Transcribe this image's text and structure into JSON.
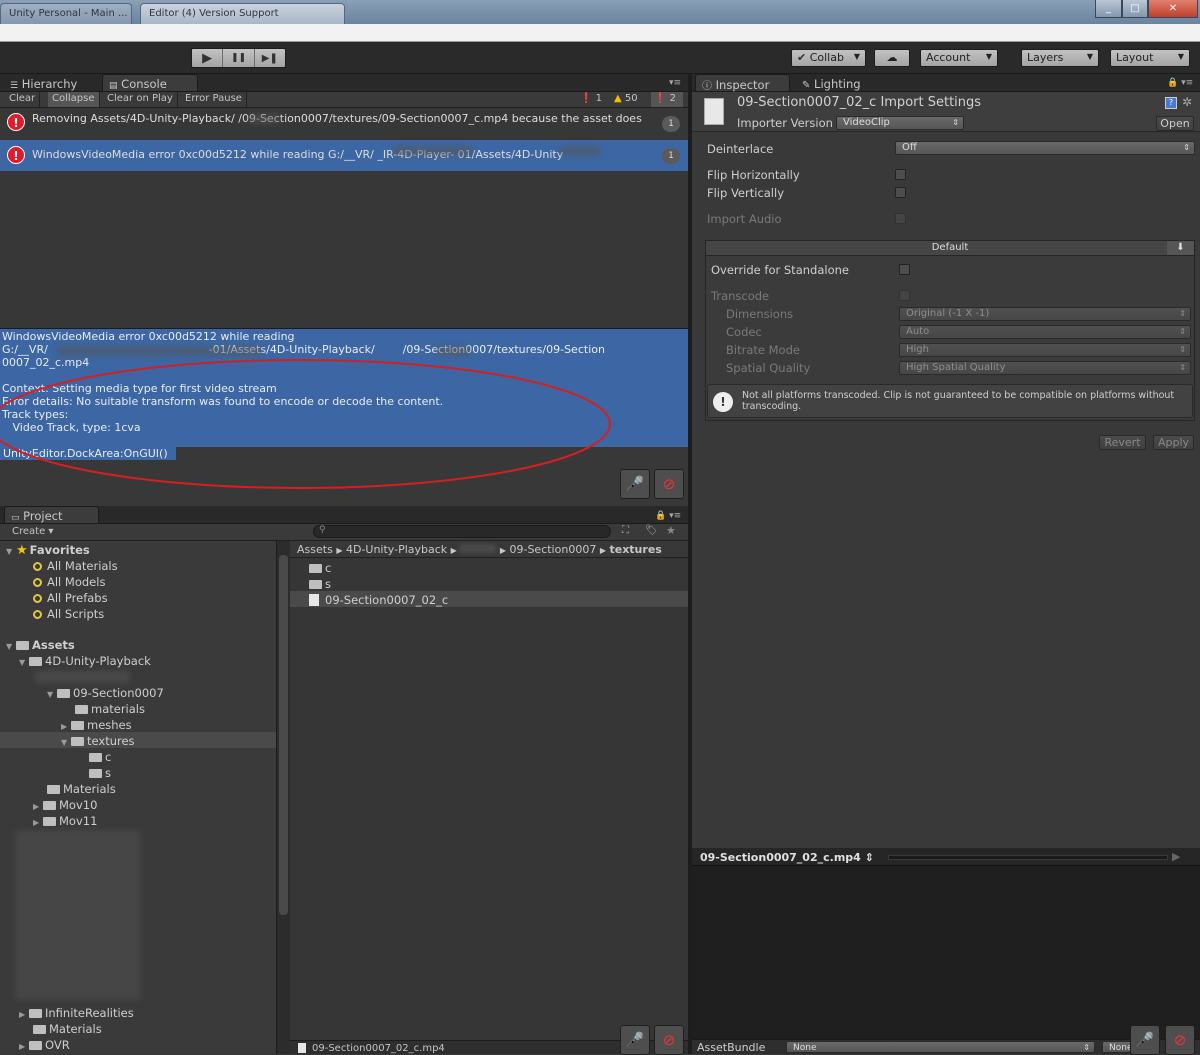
{
  "window": {
    "tabs": [
      "Unity Personal - Main ...",
      "Editor (4) Version Support"
    ],
    "controls": [
      "_",
      "□",
      "✕"
    ]
  },
  "toolbar": {
    "play_icons": [
      "▶",
      "❚❚",
      "▶❚"
    ],
    "collab_label": "Collab",
    "cloud_icon": "cloud-icon",
    "account_label": "Account",
    "layers_label": "Layers",
    "layout_label": "Layout"
  },
  "hierarchy_tab": "Hierarchy",
  "console": {
    "tab": "Console",
    "buttons": [
      "Clear",
      "Collapse",
      "Clear on Play",
      "Error Pause"
    ],
    "counts": {
      "info": "1",
      "warnings": "50",
      "errors": "2"
    },
    "entries": [
      {
        "text": "Removing Assets/4D-Unity-Playback/          /09-Section0007/textures/09-Section0007_c.mp4 because the asset does",
        "count": "1",
        "selected": false
      },
      {
        "text": "WindowsVideoMedia error 0xc00d5212 while reading G:/__VR/                   _IR-4D-Player-          01/Assets/4D-Unity",
        "count": "1",
        "selected": true
      }
    ],
    "detail_lines": [
      "WindowsVideoMedia error 0xc00d5212 while reading",
      "G:/__VR/                                              -01/Assets/4D-Unity-Playback/        /09-Section0007/textures/09-Section",
      "0007_02_c.mp4",
      "",
      "Context: Setting media type for first video stream",
      "Error details: No suitable transform was found to encode or decode the content.",
      "Track types:",
      "   Video Track, type: 1cva",
      "",
      "UnityEditor.DockArea:OnGUI()"
    ]
  },
  "project": {
    "tab": "Project",
    "create_label": "Create",
    "search_placeholder": "",
    "favorites_label": "Favorites",
    "favorites": [
      "All Materials",
      "All Models",
      "All Prefabs",
      "All Scripts"
    ],
    "assets_label": "Assets",
    "tree": {
      "playback": "4D-Unity-Playback",
      "section": "09-Section0007",
      "materials": "materials",
      "meshes": "meshes",
      "textures": "textures",
      "c": "c",
      "s": "s",
      "Materials": "Materials",
      "mov10": "Mov10",
      "mov11": "Mov11",
      "infinite": "InfiniteRealities",
      "materials2": "Materials",
      "ovr": "OVR"
    },
    "breadcrumb": [
      "Assets",
      "4D-Unity-Playback",
      "",
      "09-Section0007",
      "textures"
    ],
    "files": [
      {
        "name": "c",
        "type": "folder"
      },
      {
        "name": "s",
        "type": "folder"
      },
      {
        "name": "09-Section0007_02_c",
        "type": "file"
      }
    ],
    "footer_file": "09-Section0007_02_c.mp4"
  },
  "inspector": {
    "tab": "Inspector",
    "lighting_tab": "Lighting",
    "title": "09-Section0007_02_c Import Settings",
    "importer_version_label": "Importer Version",
    "importer_version_value": "VideoClip",
    "open_label": "Open",
    "deinterlace_label": "Deinterlace",
    "deinterlace_value": "Off",
    "flip_h": "Flip Horizontally",
    "flip_v": "Flip Vertically",
    "import_audio": "Import Audio",
    "platform_header": "Default",
    "override_label": "Override for Standalone",
    "transcode_label": "Transcode",
    "dimensions_label": "Dimensions",
    "dimensions_value": "Original (-1 X -1)",
    "codec_label": "Codec",
    "codec_value": "Auto",
    "bitrate_label": "Bitrate Mode",
    "bitrate_value": "High",
    "quality_label": "Spatial Quality",
    "quality_value": "High Spatial Quality",
    "warning_text": "Not all platforms transcoded. Clip is not guaranteed to be compatible on platforms without transcoding.",
    "revert_label": "Revert",
    "apply_label": "Apply",
    "preview_file": "09-Section0007_02_c.mp4",
    "assetbundle_label": "AssetBundle",
    "assetbundle_value": "None",
    "assetbundle_variant": "None"
  }
}
